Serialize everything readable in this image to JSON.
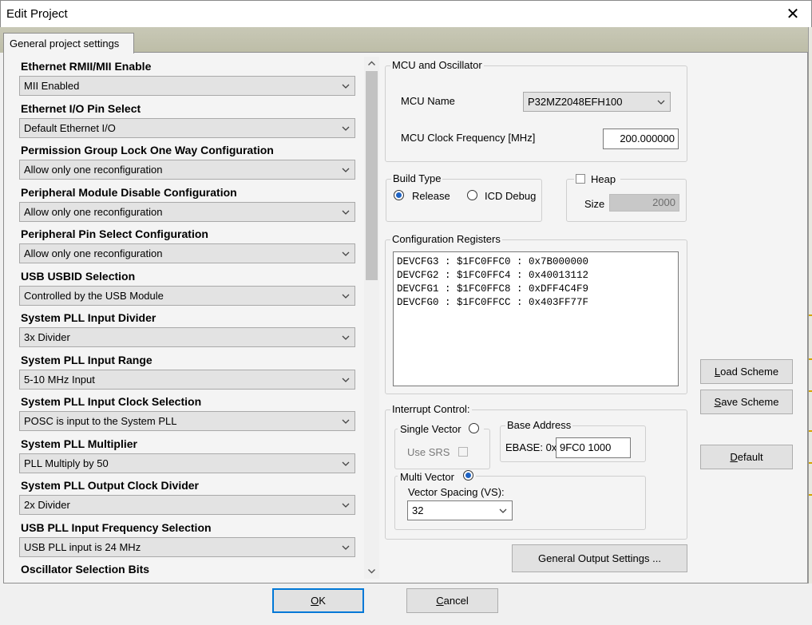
{
  "window": {
    "title": "Edit Project"
  },
  "tab": {
    "label": "General project settings"
  },
  "options": [
    {
      "label": "Ethernet RMII/MII Enable",
      "value": "MII Enabled"
    },
    {
      "label": "Ethernet I/O Pin Select",
      "value": "Default Ethernet I/O"
    },
    {
      "label": "Permission Group Lock One Way Configuration",
      "value": "Allow only one reconfiguration"
    },
    {
      "label": "Peripheral Module Disable Configuration",
      "value": "Allow only one reconfiguration"
    },
    {
      "label": "Peripheral Pin Select Configuration",
      "value": "Allow only one reconfiguration"
    },
    {
      "label": "USB USBID Selection",
      "value": "Controlled by the USB Module"
    },
    {
      "label": "System PLL Input Divider",
      "value": "3x Divider"
    },
    {
      "label": "System PLL Input Range",
      "value": "5-10 MHz Input"
    },
    {
      "label": "System PLL Input Clock Selection",
      "value": "POSC is input to the System PLL"
    },
    {
      "label": "System PLL Multiplier",
      "value": "PLL Multiply by 50"
    },
    {
      "label": "System PLL Output Clock Divider",
      "value": "2x Divider"
    },
    {
      "label": "USB PLL Input Frequency Selection",
      "value": "USB PLL input is 24 MHz"
    },
    {
      "label": "Oscillator Selection Bits",
      "value": ""
    }
  ],
  "mcu": {
    "group_title": "MCU and Oscillator",
    "name_label": "MCU Name",
    "name_value": "P32MZ2048EFH100",
    "clock_label": "MCU Clock Frequency [MHz]",
    "clock_value": "200.000000"
  },
  "build": {
    "group_title": "Build Type",
    "release_label": "Release",
    "debug_label": "ICD Debug",
    "selected": "Release"
  },
  "heap": {
    "label": "Heap",
    "size_label": "Size",
    "size_value": "2000",
    "checked": false
  },
  "config_registers": {
    "group_title": "Configuration Registers",
    "lines": [
      "DEVCFG3 : $1FC0FFC0 : 0x7B000000",
      "DEVCFG2 : $1FC0FFC4 : 0x40013112",
      "DEVCFG1 : $1FC0FFC8 : 0xDFF4C4F9",
      "DEVCFG0 : $1FC0FFCC : 0x403FF77F"
    ]
  },
  "interrupt": {
    "group_title": "Interrupt Control:",
    "single_vector_label": "Single Vector",
    "use_srs_label": "Use SRS",
    "base_address_title": "Base Address",
    "ebase_label": "EBASE: 0x",
    "ebase_value": "9FC0 1000",
    "multi_vector_label": "Multi Vector",
    "vector_spacing_label": "Vector Spacing (VS):",
    "vector_spacing_value": "32",
    "selected": "Multi Vector"
  },
  "buttons": {
    "load_scheme_pre": "",
    "load_scheme_u": "L",
    "load_scheme_post": "oad Scheme",
    "save_scheme_u": "S",
    "save_scheme_post": "ave Scheme",
    "default_u": "D",
    "default_post": "efault",
    "general_output": "General Output Settings ...",
    "ok_u": "O",
    "ok_post": "K",
    "cancel_u": "C",
    "cancel_post": "ancel"
  },
  "icons": [
    "close-icon",
    "chevron-down-icon",
    "scroll-up-icon",
    "scroll-down-icon"
  ]
}
